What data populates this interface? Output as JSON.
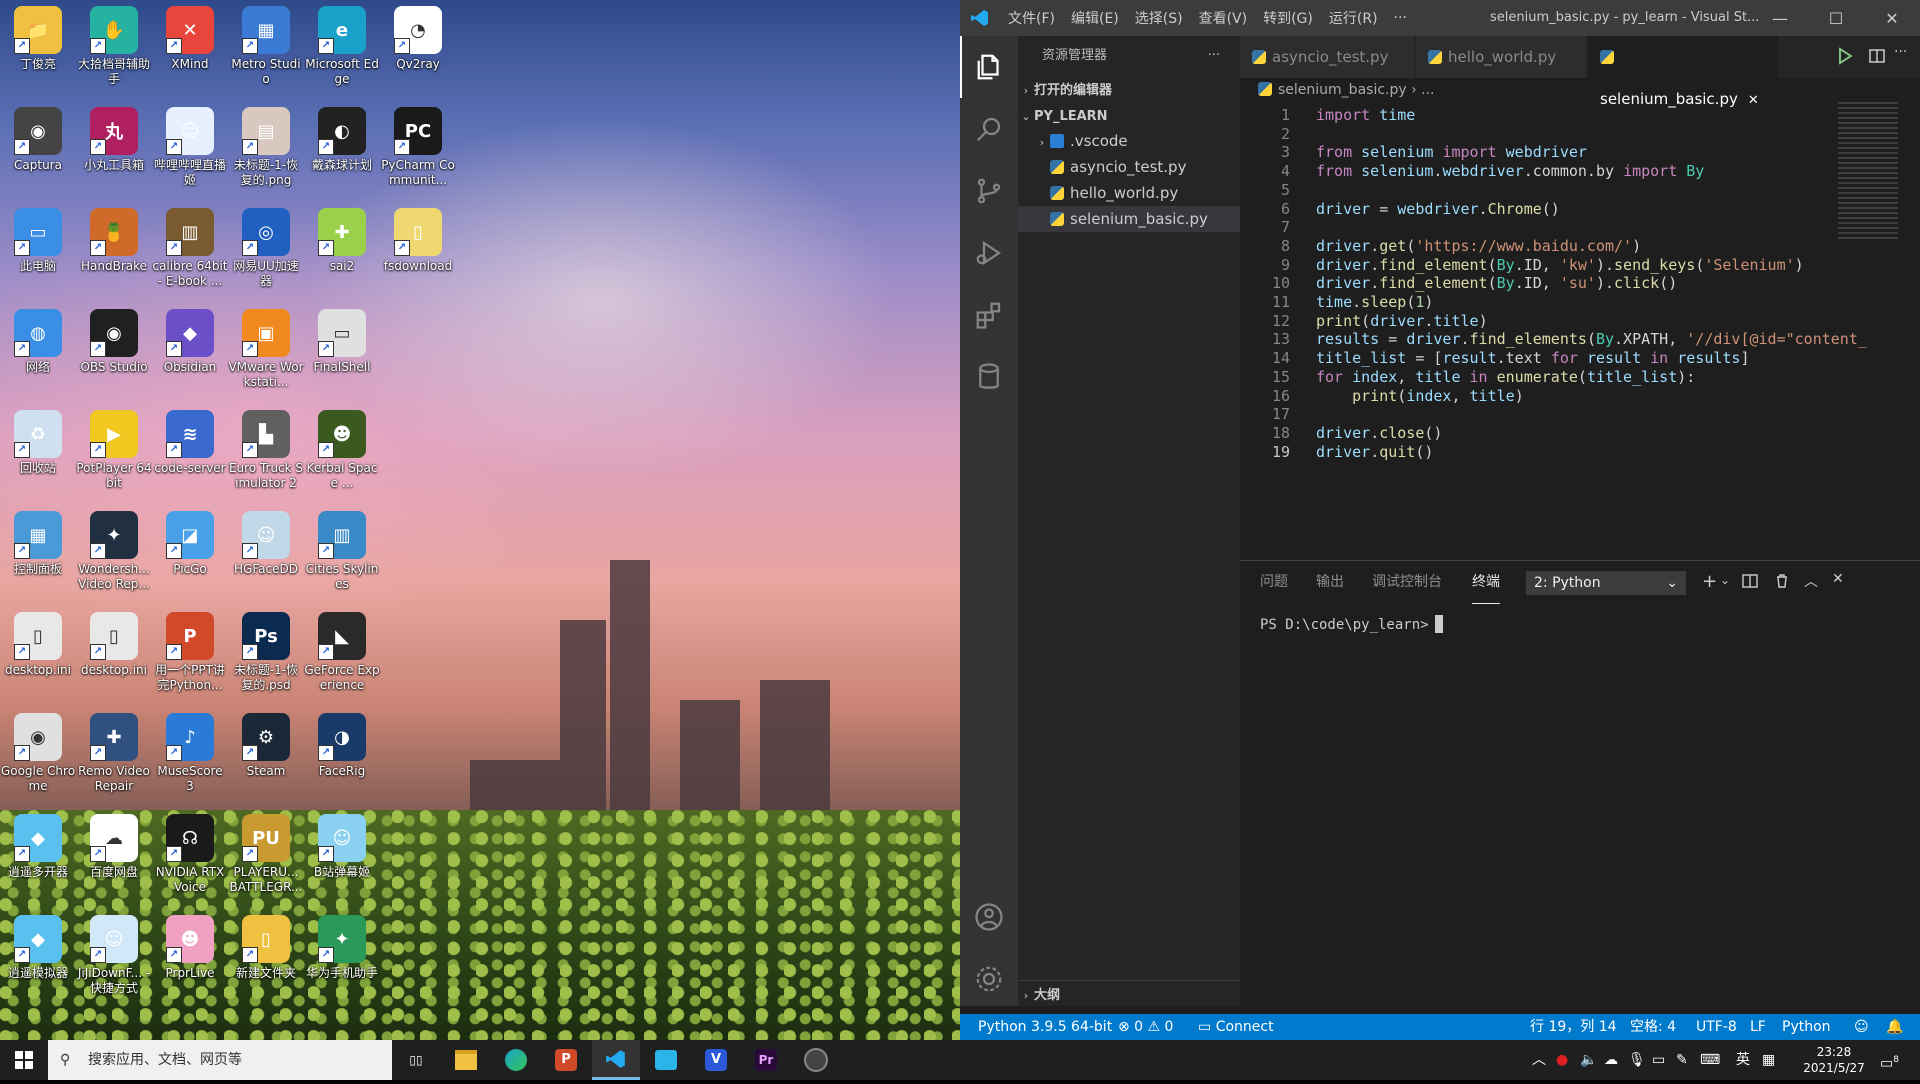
{
  "desktop": {
    "icons": [
      {
        "label": "丁俊亮",
        "color": "#f0c040",
        "glyph": "📁"
      },
      {
        "label": "大拾档哥辅助手",
        "color": "#25b2a0",
        "glyph": "✋"
      },
      {
        "label": "XMind",
        "color": "#e8453c",
        "glyph": "✕"
      },
      {
        "label": "Metro Studio",
        "color": "#3a7bd5",
        "glyph": "▦"
      },
      {
        "label": "Microsoft Edge",
        "color": "#1aa1c9",
        "glyph": "e"
      },
      {
        "label": "Qv2ray",
        "color": "#ffffff",
        "glyph": "◔"
      },
      {
        "label": "Captura",
        "color": "#444444",
        "glyph": "◉"
      },
      {
        "label": "小丸工具箱",
        "color": "#b02060",
        "glyph": "丸"
      },
      {
        "label": "哔哩哔哩直播姬",
        "color": "#e6f0ff",
        "glyph": "☺"
      },
      {
        "label": "未标题-1-恢复的.png",
        "color": "#d8c8c0",
        "glyph": "▤"
      },
      {
        "label": "戴森球计划",
        "color": "#222222",
        "glyph": "◐"
      },
      {
        "label": "PyCharm Communit...",
        "color": "#1a1a1a",
        "glyph": "PC"
      },
      {
        "label": "此电脑",
        "color": "#3a8ee6",
        "glyph": "▭"
      },
      {
        "label": "HandBrake",
        "color": "#d06a2a",
        "glyph": "🍍"
      },
      {
        "label": "calibre 64bit - E-book ...",
        "color": "#7a5a30",
        "glyph": "▥"
      },
      {
        "label": "网易UU加速器",
        "color": "#2060c0",
        "glyph": "◎"
      },
      {
        "label": "sai2",
        "color": "#9ad04a",
        "glyph": "✚"
      },
      {
        "label": "fsdownload",
        "color": "#f0d870",
        "glyph": "▯"
      },
      {
        "label": "网络",
        "color": "#3a8ee6",
        "glyph": "◍"
      },
      {
        "label": "OBS Studio",
        "color": "#202020",
        "glyph": "◉"
      },
      {
        "label": "Obsidian",
        "color": "#6a4fc8",
        "glyph": "◆"
      },
      {
        "label": "VMware Workstati...",
        "color": "#f08a20",
        "glyph": "▣"
      },
      {
        "label": "FinalShell",
        "color": "#e0e0e0",
        "glyph": "▭"
      },
      {
        "label": "",
        "color": "transparent",
        "glyph": ""
      },
      {
        "label": "回收站",
        "color": "#cfe0f0",
        "glyph": "♻"
      },
      {
        "label": "PotPlayer 64 bit",
        "color": "#f0c820",
        "glyph": "▶"
      },
      {
        "label": "code-server",
        "color": "#3a6ad0",
        "glyph": "≋"
      },
      {
        "label": "Euro Truck Simulator 2",
        "color": "#606060",
        "glyph": "▙"
      },
      {
        "label": "Kerbal Space ...",
        "color": "#3a5a20",
        "glyph": "☻"
      },
      {
        "label": "",
        "color": "transparent",
        "glyph": ""
      },
      {
        "label": "控制面板",
        "color": "#4a9ad8",
        "glyph": "▦"
      },
      {
        "label": "Wondersh... Video Rep...",
        "color": "#203040",
        "glyph": "✦"
      },
      {
        "label": "PicGo",
        "color": "#4aa0e8",
        "glyph": "◪"
      },
      {
        "label": "HGFaceDD",
        "color": "#c0d8e8",
        "glyph": "☺"
      },
      {
        "label": "Cities Skylines",
        "color": "#3a8ac8",
        "glyph": "▥"
      },
      {
        "label": "",
        "color": "transparent",
        "glyph": ""
      },
      {
        "label": "desktop.ini",
        "color": "#e8e8e8",
        "glyph": "▯"
      },
      {
        "label": "desktop.ini",
        "color": "#e8e8e8",
        "glyph": "▯"
      },
      {
        "label": "用一个PPT讲完Python...",
        "color": "#d04a2a",
        "glyph": "P"
      },
      {
        "label": "未标题-1-恢复的.psd",
        "color": "#0a2a50",
        "glyph": "Ps"
      },
      {
        "label": "GeForce Experience",
        "color": "#2a2a2a",
        "glyph": "◣"
      },
      {
        "label": "",
        "color": "transparent",
        "glyph": ""
      },
      {
        "label": "Google Chrome",
        "color": "#e0e0e0",
        "glyph": "◉"
      },
      {
        "label": "Remo Video Repair",
        "color": "#305080",
        "glyph": "✚"
      },
      {
        "label": "MuseScore 3",
        "color": "#2a7ad8",
        "glyph": "♪"
      },
      {
        "label": "Steam",
        "color": "#1b2838",
        "glyph": "⚙"
      },
      {
        "label": "FaceRig",
        "color": "#1a3a6a",
        "glyph": "◑"
      },
      {
        "label": "",
        "color": "transparent",
        "glyph": ""
      },
      {
        "label": "逍遥多开器",
        "color": "#5ac0f0",
        "glyph": "◆"
      },
      {
        "label": "百度网盘",
        "color": "#ffffff",
        "glyph": "☁"
      },
      {
        "label": "NVIDIA RTX Voice",
        "color": "#1a1a1a",
        "glyph": "☊"
      },
      {
        "label": "PLAYERU... BATTLEGR...",
        "color": "#c89a30",
        "glyph": "PU"
      },
      {
        "label": "B站弹幕姬",
        "color": "#8ad0f0",
        "glyph": "☺"
      },
      {
        "label": "",
        "color": "transparent",
        "glyph": ""
      },
      {
        "label": "逍遥模拟器",
        "color": "#5ac0f0",
        "glyph": "◆"
      },
      {
        "label": "JiJiDownF... - 快捷方式",
        "color": "#d0e8f8",
        "glyph": "☺"
      },
      {
        "label": "PrprLive",
        "color": "#f0a0c0",
        "glyph": "☻"
      },
      {
        "label": "新建文件夹",
        "color": "#f0c040",
        "glyph": "▯"
      },
      {
        "label": "华为手机助手",
        "color": "#2a9a5a",
        "glyph": "✦"
      },
      {
        "label": "",
        "color": "transparent",
        "glyph": ""
      }
    ]
  },
  "vscode": {
    "menu": [
      "文件(F)",
      "编辑(E)",
      "选择(S)",
      "查看(V)",
      "转到(G)",
      "运行(R)",
      "···"
    ],
    "window_title": "selenium_basic.py - py_learn - Visual St...",
    "window_buttons": [
      "—",
      "☐",
      "✕"
    ],
    "sidebar": {
      "title": "资源管理器",
      "more": "···",
      "open_editors": "打开的编辑器",
      "project": "PY_LEARN",
      "items": [
        ".vscode",
        "asyncio_test.py",
        "hello_world.py",
        "selenium_basic.py"
      ],
      "outline": "大纲"
    },
    "tabs": [
      "asyncio_test.py",
      "hello_world.py",
      "selenium_basic.py"
    ],
    "tab_close": "✕",
    "breadcrumb": "selenium_basic.py",
    "breadcrumb_rest": "› ...",
    "code_lines": [
      "import time",
      "",
      "from selenium import webdriver",
      "from selenium.webdriver.common.by import By",
      "",
      "driver = webdriver.Chrome()",
      "",
      "driver.get('https://www.baidu.com/')",
      "driver.find_element(By.ID, 'kw').send_keys('Selenium')",
      "driver.find_element(By.ID, 'su').click()",
      "time.sleep(1)",
      "print(driver.title)",
      "results = driver.find_elements(By.XPATH, '//div[@id=\"content_",
      "title_list = [result.text for result in results]",
      "for index, title in enumerate(title_list):",
      "    print(index, title)",
      "",
      "driver.close()",
      "driver.quit()"
    ],
    "current_line": 19,
    "panel": {
      "tabs": [
        "问题",
        "输出",
        "调试控制台",
        "终端"
      ],
      "active_tab": "终端",
      "more": "···",
      "terminal_select": "2: Python",
      "prompt": "PS D:\\code\\py_learn>"
    },
    "status": {
      "python": "Python 3.9.5 64-bit",
      "problems": "⊗ 0 ⚠ 0",
      "connect": "Connect",
      "position": "行 19，列 14",
      "spaces": "空格: 4",
      "encoding": "UTF-8",
      "eol": "LF",
      "language": "Python"
    }
  },
  "taskbar": {
    "search_placeholder": "搜索应用、文档、网页等",
    "time": "23:28",
    "date": "2021/5/27",
    "ime": "英",
    "notification_count": "8"
  }
}
